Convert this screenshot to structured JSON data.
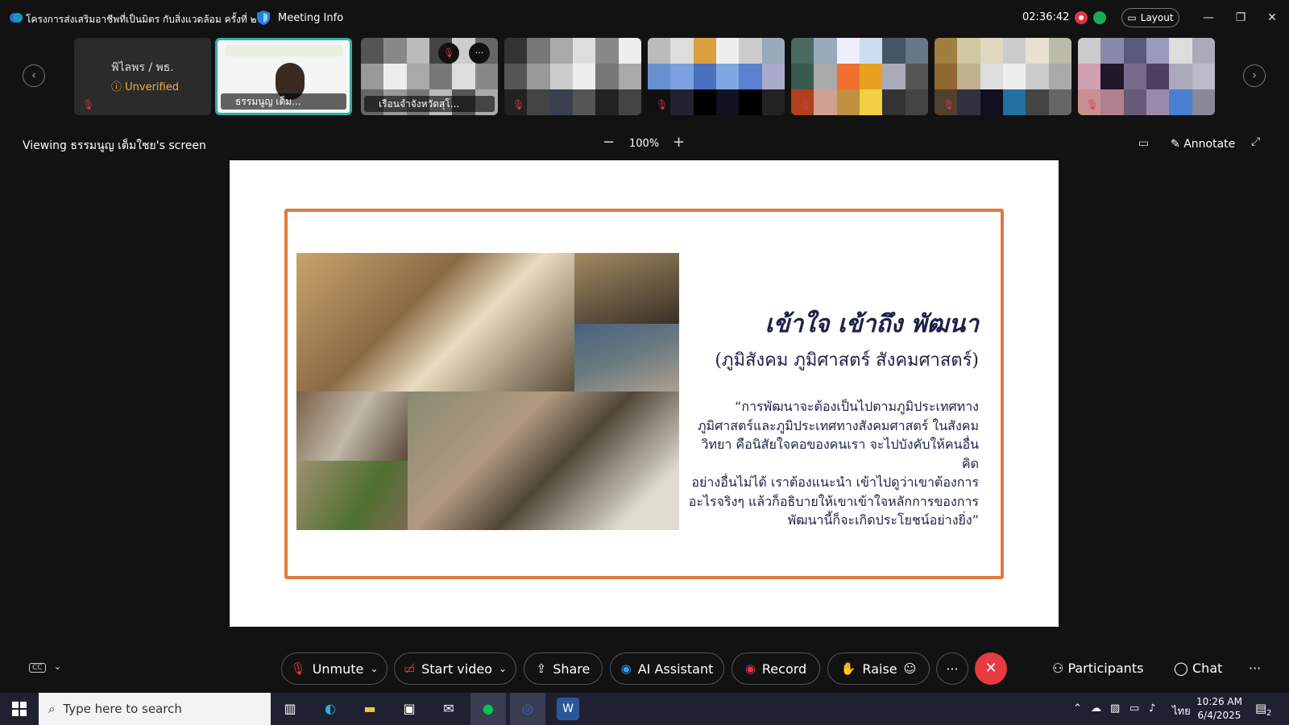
{
  "titlebar": {
    "meeting_title": "โครงการส่งเสริมอาชีพที่เป็นมิตร กับสิ่งแวดล้อม ครั้งที่ ๒",
    "meeting_info": "Meeting Info",
    "timer": "02:36:42",
    "layout_label": "Layout",
    "minimize": "—",
    "restore": "❐",
    "close": "✕"
  },
  "participants": [
    {
      "name": "พิไลพร / พธ.",
      "status": "Unverified"
    },
    {
      "name": "ธรรมนูญ เต็ม..."
    },
    {
      "name": "เรือนจำจังหวัดสุโ..."
    }
  ],
  "strip": {
    "prev": "‹",
    "next": "›",
    "more": "···"
  },
  "viewing": {
    "label": "Viewing ธรรมนูญ เต็มใชย's screen",
    "zoom": "100%",
    "zoom_minus": "−",
    "zoom_plus": "+",
    "annotate": "Annotate"
  },
  "slide": {
    "title": "เข้าใจ เข้าถึง พัฒนา",
    "subtitle": "(ภูมิสังคม ภูมิศาสตร์ สังคมศาสตร์)",
    "quote_lines": [
      "“การพัฒนาจะต้องเป็นไปตามภูมิประเทศทาง",
      "ภูมิศาสตร์และภูมิประเทศทางสังคมศาสตร์ ในสังคม",
      "วิทยา คือนิสัยใจคอของคนเรา จะไปบังคับให้คนอื่นคิด",
      "อย่างอื่นไม่ได้ เราต้องแนะนำ เข้าไปดูว่าเขาต้องการ",
      "อะไรจริงๆ แล้วก็อธิบายให้เขาเข้าใจหลักการของการ",
      "พัฒนานี้ก็จะเกิดประโยชน์อย่างยิ่ง”"
    ]
  },
  "toolbar": {
    "unmute": "Unmute",
    "start_video": "Start video",
    "share": "Share",
    "ai_assistant": "AI Assistant",
    "record": "Record",
    "raise": "Raise",
    "more": "···",
    "end": "✕",
    "participants": "Participants",
    "chat": "Chat",
    "overflow": "···"
  },
  "taskbar": {
    "search_placeholder": "Type here to search",
    "language": "ไทย",
    "time": "10:26 AM",
    "date": "6/4/2025",
    "notifications": "2"
  },
  "colors": {
    "accent": "#2fb0a7",
    "record_red": "#e5334b",
    "end_red": "#e53b41",
    "slide_frame": "#e07a3f",
    "slide_text": "#1d2148"
  }
}
